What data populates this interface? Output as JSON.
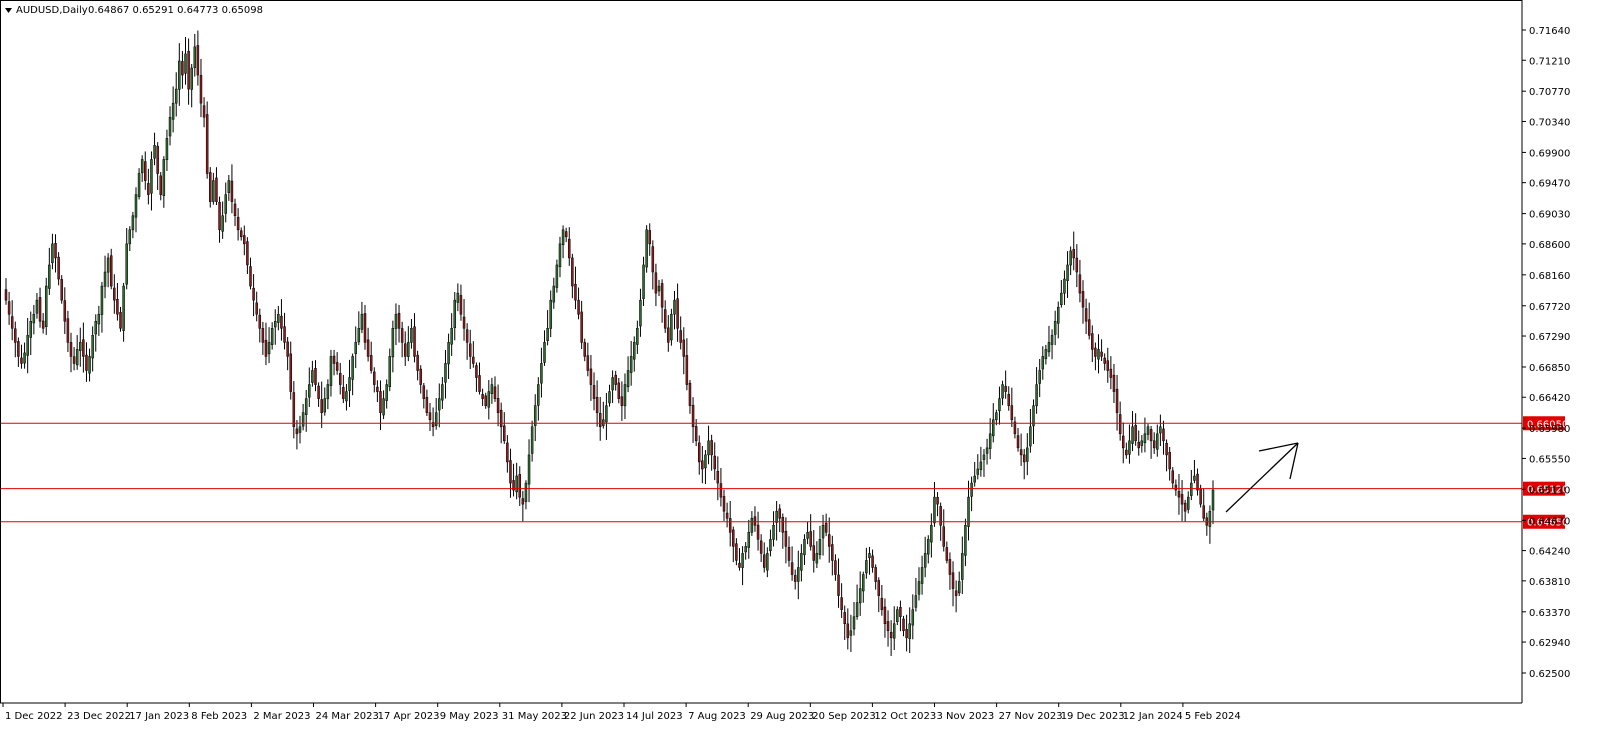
{
  "header": {
    "dropdown_icon": "triangle-down-icon",
    "symbol": "AUDUSD,Daily",
    "ohlc": "0.64867 0.65291 0.64773 0.65098"
  },
  "colors": {
    "bull": "#2e6b2e",
    "bear": "#8b1a1a",
    "wick": "#000000",
    "level_line": "#e00000",
    "badge_bg": "#e00000",
    "axis": "#000000",
    "arrow": "#000000"
  },
  "chart_data": {
    "type": "candlestick",
    "title": "AUDUSD,Daily",
    "ylim": [
      0.625,
      0.719
    ],
    "grid": false,
    "y_ticks": [
      "0.71640",
      "0.71210",
      "0.70770",
      "0.70340",
      "0.69900",
      "0.69470",
      "0.69030",
      "0.68600",
      "0.68160",
      "0.67720",
      "0.67290",
      "0.66850",
      "0.66420",
      "0.65980",
      "0.65550",
      "0.65110",
      "0.64670",
      "0.64240",
      "0.63810",
      "0.63370",
      "0.62940",
      "0.62500"
    ],
    "x_labels": [
      "1 Dec 2022",
      "23 Dec 2022",
      "17 Jan 2023",
      "8 Feb 2023",
      "2 Mar 2023",
      "24 Mar 2023",
      "17 Apr 2023",
      "9 May 2023",
      "31 May 2023",
      "22 Jun 2023",
      "14 Jul 2023",
      "7 Aug 2023",
      "29 Aug 2023",
      "20 Sep 2023",
      "12 Oct 2023",
      "3 Nov 2023",
      "27 Nov 2023",
      "19 Dec 2023",
      "12 Jan 2024",
      "5 Feb 2024"
    ],
    "levels": [
      {
        "value": 0.6605,
        "label": "0.66050"
      },
      {
        "value": 0.6512,
        "label": "0.65120"
      },
      {
        "value": 0.6465,
        "label": "0.64650"
      }
    ],
    "closes": [
      0.678,
      0.676,
      0.674,
      0.672,
      0.67,
      0.669,
      0.6705,
      0.673,
      0.675,
      0.676,
      0.678,
      0.675,
      0.674,
      0.68,
      0.683,
      0.686,
      0.684,
      0.681,
      0.678,
      0.675,
      0.672,
      0.67,
      0.669,
      0.671,
      0.672,
      0.67,
      0.668,
      0.67,
      0.673,
      0.675,
      0.676,
      0.68,
      0.682,
      0.684,
      0.68,
      0.678,
      0.676,
      0.674,
      0.68,
      0.686,
      0.688,
      0.69,
      0.693,
      0.696,
      0.698,
      0.695,
      0.693,
      0.698,
      0.7,
      0.696,
      0.693,
      0.698,
      0.701,
      0.704,
      0.706,
      0.708,
      0.712,
      0.71,
      0.713,
      0.708,
      0.711,
      0.714,
      0.71,
      0.706,
      0.704,
      0.696,
      0.692,
      0.695,
      0.692,
      0.688,
      0.69,
      0.693,
      0.695,
      0.692,
      0.69,
      0.688,
      0.687,
      0.686,
      0.683,
      0.68,
      0.678,
      0.676,
      0.674,
      0.672,
      0.67,
      0.672,
      0.674,
      0.675,
      0.676,
      0.674,
      0.672,
      0.67,
      0.665,
      0.66,
      0.659,
      0.66,
      0.662,
      0.664,
      0.666,
      0.668,
      0.666,
      0.664,
      0.662,
      0.664,
      0.666,
      0.67,
      0.669,
      0.668,
      0.666,
      0.664,
      0.665,
      0.667,
      0.67,
      0.672,
      0.674,
      0.676,
      0.672,
      0.67,
      0.668,
      0.666,
      0.665,
      0.662,
      0.664,
      0.666,
      0.67,
      0.674,
      0.676,
      0.674,
      0.672,
      0.67,
      0.672,
      0.674,
      0.67,
      0.668,
      0.666,
      0.664,
      0.662,
      0.661,
      0.66,
      0.662,
      0.664,
      0.666,
      0.669,
      0.672,
      0.674,
      0.678,
      0.679,
      0.676,
      0.674,
      0.672,
      0.67,
      0.669,
      0.667,
      0.665,
      0.664,
      0.663,
      0.665,
      0.666,
      0.664,
      0.662,
      0.66,
      0.658,
      0.655,
      0.652,
      0.651,
      0.653,
      0.65,
      0.649,
      0.652,
      0.656,
      0.66,
      0.663,
      0.666,
      0.669,
      0.672,
      0.674,
      0.678,
      0.68,
      0.683,
      0.686,
      0.688,
      0.687,
      0.684,
      0.68,
      0.678,
      0.676,
      0.672,
      0.67,
      0.668,
      0.666,
      0.664,
      0.662,
      0.66,
      0.661,
      0.663,
      0.665,
      0.667,
      0.666,
      0.664,
      0.663,
      0.666,
      0.668,
      0.67,
      0.672,
      0.674,
      0.678,
      0.683,
      0.688,
      0.686,
      0.682,
      0.679,
      0.68,
      0.677,
      0.674,
      0.672,
      0.676,
      0.678,
      0.674,
      0.672,
      0.67,
      0.666,
      0.663,
      0.66,
      0.658,
      0.655,
      0.654,
      0.656,
      0.658,
      0.656,
      0.654,
      0.652,
      0.65,
      0.648,
      0.647,
      0.645,
      0.643,
      0.641,
      0.64,
      0.642,
      0.643,
      0.645,
      0.647,
      0.646,
      0.644,
      0.642,
      0.64,
      0.642,
      0.644,
      0.646,
      0.648,
      0.647,
      0.645,
      0.643,
      0.641,
      0.639,
      0.638,
      0.64,
      0.642,
      0.644,
      0.645,
      0.643,
      0.641,
      0.642,
      0.644,
      0.646,
      0.645,
      0.643,
      0.641,
      0.639,
      0.636,
      0.634,
      0.632,
      0.63,
      0.631,
      0.633,
      0.635,
      0.637,
      0.639,
      0.641,
      0.642,
      0.64,
      0.638,
      0.636,
      0.634,
      0.632,
      0.631,
      0.63,
      0.632,
      0.634,
      0.633,
      0.631,
      0.63,
      0.632,
      0.634,
      0.636,
      0.638,
      0.64,
      0.642,
      0.644,
      0.646,
      0.65,
      0.649,
      0.646,
      0.643,
      0.641,
      0.639,
      0.637,
      0.636,
      0.638,
      0.642,
      0.646,
      0.65,
      0.652,
      0.653,
      0.654,
      0.655,
      0.656,
      0.657,
      0.659,
      0.661,
      0.662,
      0.664,
      0.666,
      0.665,
      0.663,
      0.661,
      0.659,
      0.657,
      0.656,
      0.655,
      0.657,
      0.66,
      0.663,
      0.666,
      0.668,
      0.67,
      0.671,
      0.672,
      0.673,
      0.675,
      0.677,
      0.679,
      0.681,
      0.683,
      0.685,
      0.684,
      0.682,
      0.679,
      0.677,
      0.675,
      0.673,
      0.671,
      0.67,
      0.671,
      0.67,
      0.669,
      0.668,
      0.667,
      0.665,
      0.662,
      0.659,
      0.657,
      0.656,
      0.658,
      0.66,
      0.658,
      0.657,
      0.658,
      0.659,
      0.66,
      0.658,
      0.657,
      0.659,
      0.66,
      0.658,
      0.656,
      0.654,
      0.652,
      0.651,
      0.65,
      0.649,
      0.648,
      0.65,
      0.652,
      0.653,
      0.651,
      0.649,
      0.647,
      0.646,
      0.648,
      0.651
    ]
  }
}
